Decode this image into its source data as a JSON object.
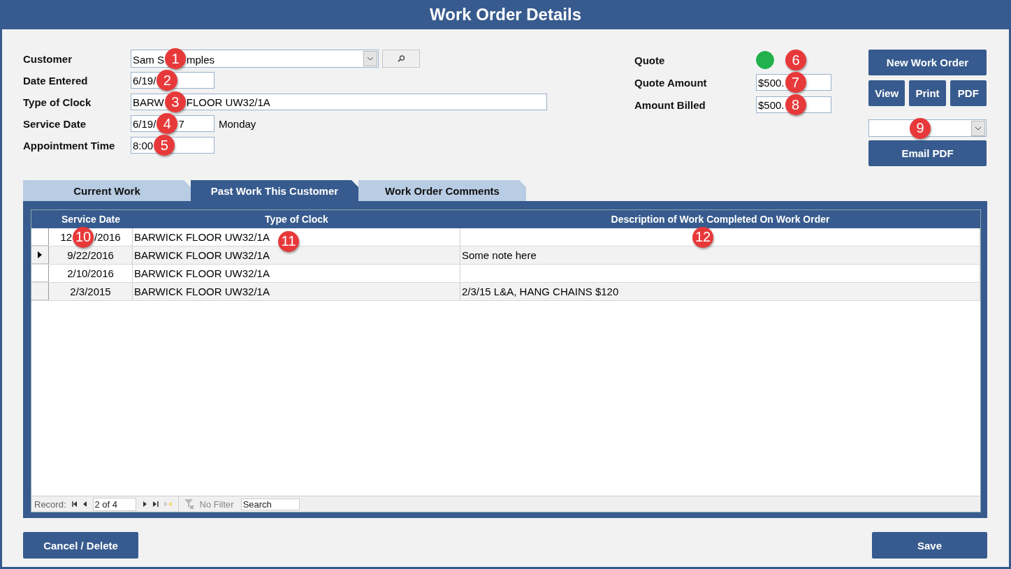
{
  "window": {
    "title": "Work Order Details"
  },
  "form": {
    "fields": [
      {
        "label": "Customer",
        "value": "Sam S",
        "callout": "1",
        "value_after": "mples",
        "kind": "combo"
      },
      {
        "label": "Date Entered",
        "value": "6/19/",
        "callout": "2",
        "kind": "short"
      },
      {
        "label": "Type of Clock",
        "value": "BARW",
        "callout": "3",
        "value_after": "FLOOR UW32/1A",
        "kind": "long"
      },
      {
        "label": "Service Date",
        "value": "6/19/",
        "callout": "4",
        "value_after": "7",
        "kind": "short",
        "note": "Monday"
      },
      {
        "label": "Appointment Time",
        "value": "8:00",
        "callout": "5",
        "kind": "short"
      }
    ],
    "quote": {
      "label": "Quote",
      "on": true,
      "color": "#22b14c",
      "callout": "6"
    },
    "amounts": [
      {
        "label": "Quote Amount",
        "value": "$500.",
        "callout": "7"
      },
      {
        "label": "Amount Billed",
        "value": "$500.",
        "callout": "8"
      }
    ]
  },
  "actions": {
    "new": "New Work Order",
    "small": [
      "View",
      "Print",
      "PDF"
    ],
    "email": "Email PDF",
    "dropdown_callout": "9"
  },
  "tabs": [
    {
      "label": "Current Work",
      "selected": false
    },
    {
      "label": "Past Work This Customer",
      "selected": true
    },
    {
      "label": "Work Order Comments",
      "selected": false
    }
  ],
  "table": {
    "columns": [
      "Service Date",
      "Type of Clock",
      "Description of Work Completed On Work Order"
    ],
    "rows": [
      {
        "service_date": "12",
        "date_callout": "10",
        "service_date_after": "/2016",
        "type": "BARWICK FLOOR UW32/1A",
        "type_callout": "11",
        "description_callout": "12",
        "selected": false
      },
      {
        "service_date": "9/22/2016",
        "type": "BARWICK FLOOR UW32/1A",
        "description": "Some note here",
        "selected": true
      },
      {
        "service_date": "2/10/2016",
        "type": "BARWICK FLOOR UW32/1A",
        "selected": false
      },
      {
        "service_date": "2/3/2015",
        "type": "BARWICK FLOOR UW32/1A",
        "description": "2/3/15 L&A, HANG CHAINS $120",
        "selected": false
      }
    ]
  },
  "navigator": {
    "label": "Record:",
    "position": "2 of 4",
    "filter": "No Filter",
    "search_placeholder": "Search"
  },
  "footer": {
    "cancel": "Cancel / Delete",
    "save": "Save"
  }
}
